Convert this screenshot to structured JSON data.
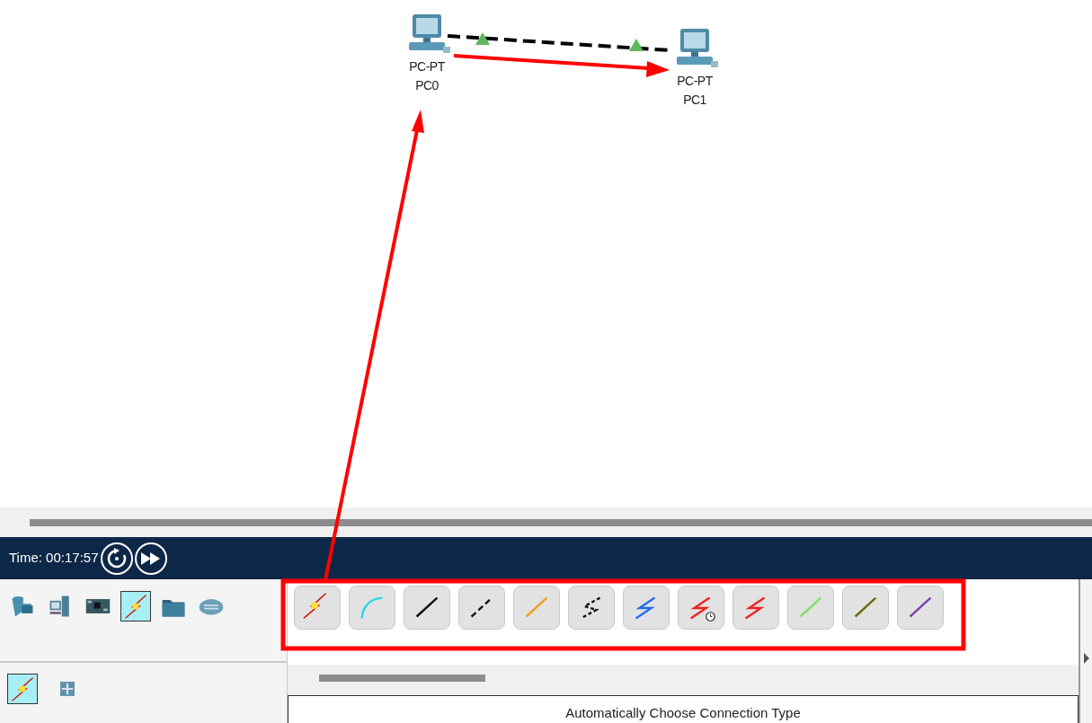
{
  "topology": {
    "devices": [
      {
        "model": "PC-PT",
        "name": "PC0"
      },
      {
        "model": "PC-PT",
        "name": "PC1"
      }
    ]
  },
  "simulation": {
    "time_label": "Time: 00:17:57"
  },
  "device_categories": [
    {
      "kind": "network",
      "selected": false
    },
    {
      "kind": "end-device",
      "selected": false
    },
    {
      "kind": "component",
      "selected": false
    },
    {
      "kind": "connection",
      "selected": true
    },
    {
      "kind": "folder",
      "selected": false
    },
    {
      "kind": "cloud",
      "selected": false
    }
  ],
  "subcategories": [
    {
      "kind": "connection",
      "selected": true
    },
    {
      "kind": "grid",
      "selected": false
    }
  ],
  "cables": [
    {
      "kind": "auto"
    },
    {
      "kind": "console"
    },
    {
      "kind": "straight"
    },
    {
      "kind": "crossover"
    },
    {
      "kind": "fiber"
    },
    {
      "kind": "phone"
    },
    {
      "kind": "coaxial"
    },
    {
      "kind": "serial-clock"
    },
    {
      "kind": "serial"
    },
    {
      "kind": "octal"
    },
    {
      "kind": "iot"
    },
    {
      "kind": "usb"
    }
  ],
  "description": "Automatically Choose Connection Type"
}
